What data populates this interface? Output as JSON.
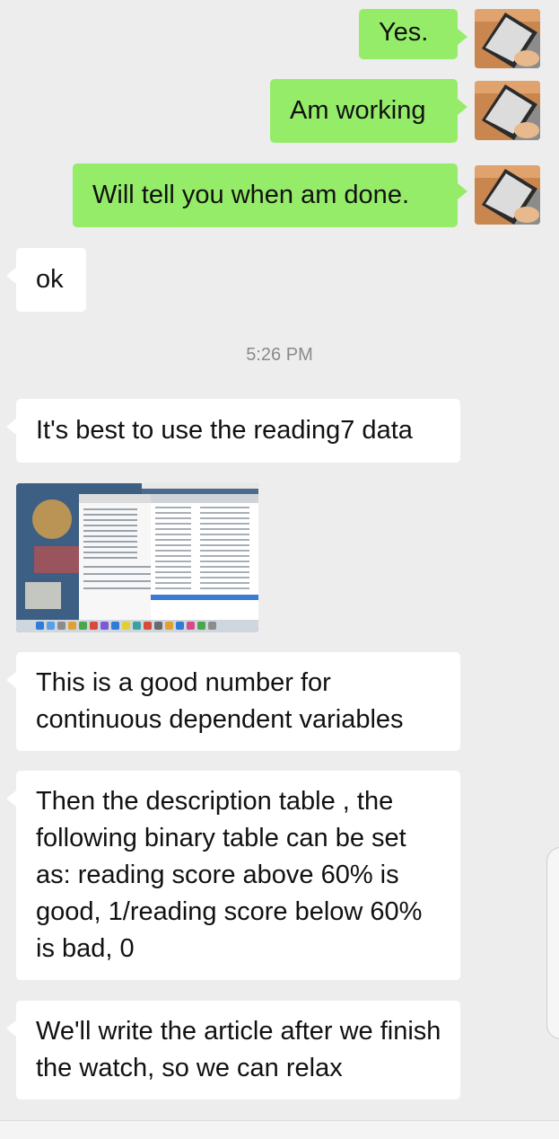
{
  "conversation": {
    "messages": [
      {
        "sender": "me",
        "text": "Yes."
      },
      {
        "sender": "me",
        "text": "Am working"
      },
      {
        "sender": "me",
        "text": "Will tell you when am done."
      },
      {
        "sender": "other",
        "text": "ok"
      },
      {
        "sender": "other",
        "text": "It's best to use the reading7 data"
      },
      {
        "sender": "other",
        "type": "image",
        "image_icon": "screenshot-image"
      },
      {
        "sender": "other",
        "text": "This is a good number for continuous dependent variables"
      },
      {
        "sender": "other",
        "text": "Then the description table , the following binary table can be set as: reading score above 60% is good, 1/reading score below 60% is bad, 0"
      },
      {
        "sender": "other",
        "text": "We'll write the article after we finish the watch, so we can relax"
      }
    ],
    "timestamp": "5:26 PM"
  },
  "colors": {
    "background": "#ededed",
    "outgoing_bubble": "#95ec69",
    "incoming_bubble": "#ffffff",
    "timestamp_text": "#8a8a8a"
  },
  "icons": {
    "avatar": "laptop-avatar-icon"
  }
}
